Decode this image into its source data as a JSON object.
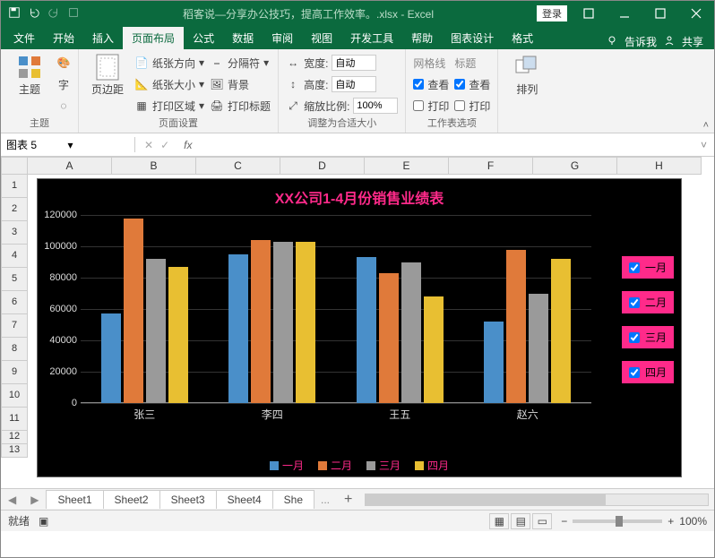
{
  "titlebar": {
    "title": "稻客说—分享办公技巧，提高工作效率。.xlsx - Excel",
    "login": "登录"
  },
  "tabs": {
    "items": [
      "文件",
      "开始",
      "插入",
      "页面布局",
      "公式",
      "数据",
      "审阅",
      "视图",
      "开发工具",
      "帮助",
      "图表设计",
      "格式"
    ],
    "active_index": 3,
    "tellme": "告诉我",
    "share": "共享"
  },
  "ribbon": {
    "theme": {
      "big": "主题",
      "label": "主题"
    },
    "pagesetup": {
      "big": "页边距",
      "orientation": "纸张方向",
      "size": "纸张大小",
      "print_area": "打印区域",
      "breaks": "分隔符",
      "background": "背景",
      "print_titles": "打印标题",
      "label": "页面设置"
    },
    "scale": {
      "width_lbl": "宽度:",
      "width_val": "自动",
      "height_lbl": "高度:",
      "height_val": "自动",
      "scale_lbl": "缩放比例:",
      "scale_val": "100%",
      "label": "调整为合适大小"
    },
    "sheetopts": {
      "grid_lbl": "网格线",
      "head_lbl": "标题",
      "view": "查看",
      "print": "打印",
      "label": "工作表选项"
    },
    "arrange": {
      "big": "排列"
    }
  },
  "fbar": {
    "name": "图表 5",
    "fx": "fx"
  },
  "columns": [
    "A",
    "B",
    "C",
    "D",
    "E",
    "F",
    "G",
    "H"
  ],
  "rows": [
    "1",
    "2",
    "3",
    "4",
    "5",
    "6",
    "7",
    "8",
    "9",
    "10",
    "11",
    "12",
    "13"
  ],
  "chart_data": {
    "type": "bar",
    "title": "XX公司1-4月份销售业绩表",
    "categories": [
      "张三",
      "李四",
      "王五",
      "赵六"
    ],
    "series": [
      {
        "name": "一月",
        "color": "#4a8fc9",
        "values": [
          57000,
          95000,
          93000,
          52000
        ]
      },
      {
        "name": "二月",
        "color": "#e07a3a",
        "values": [
          118000,
          104000,
          83000,
          98000
        ]
      },
      {
        "name": "三月",
        "color": "#9a9a9a",
        "values": [
          92000,
          103000,
          90000,
          70000
        ]
      },
      {
        "name": "四月",
        "color": "#e8bf32",
        "values": [
          87000,
          103000,
          68000,
          92000
        ]
      }
    ],
    "ylim": [
      0,
      120000
    ],
    "yticks": [
      0,
      20000,
      40000,
      60000,
      80000,
      100000,
      120000
    ],
    "legend_checkboxes": [
      "一月",
      "二月",
      "三月",
      "四月"
    ]
  },
  "sheettabs": {
    "items": [
      "Sheet1",
      "Sheet2",
      "Sheet3",
      "Sheet4",
      "She"
    ],
    "more": "...",
    "add": "+"
  },
  "status": {
    "ready": "就绪",
    "zoom": "100%"
  }
}
